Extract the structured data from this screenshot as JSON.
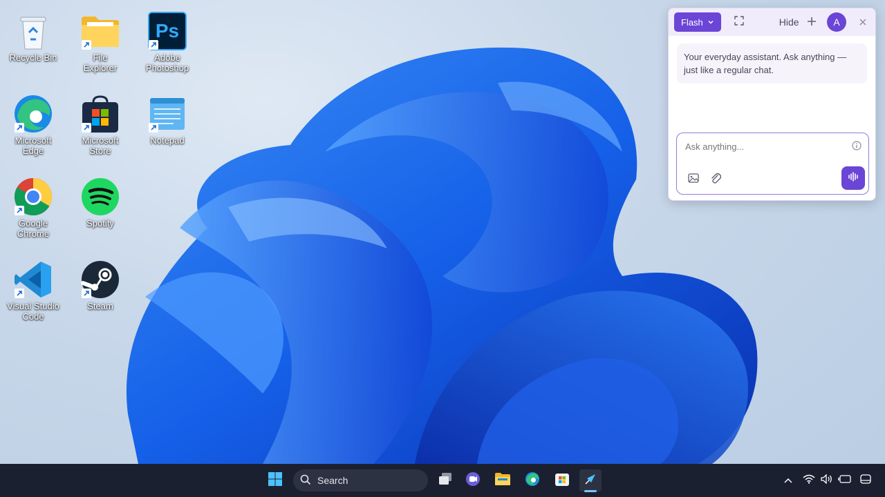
{
  "desktop": {
    "icons": [
      {
        "label": "Recycle Bin"
      },
      {
        "label": "File Explorer"
      },
      {
        "label": "Adobe Photoshop"
      },
      {
        "label": "Microsoft Edge"
      },
      {
        "label": "Microsoft Store"
      },
      {
        "label": "Notepad"
      },
      {
        "label": "Google Chrome"
      },
      {
        "label": "Spotify"
      },
      {
        "label": "Visual Studio Code"
      },
      {
        "label": "Steam"
      }
    ]
  },
  "assistant": {
    "model_label": "Flash",
    "hide_label": "Hide",
    "avatar_initial": "A",
    "intro_text": "Your everyday assistant. Ask anything — just like a regular chat.",
    "composer_placeholder": "Ask anything...",
    "accent_color": "#6b45d6"
  },
  "taskbar": {
    "search_label": "Search",
    "apps": [
      "start-icon",
      "task-view-icon",
      "teams-icon",
      "file-explorer-icon",
      "edge-icon",
      "store-icon",
      "assistant-icon"
    ],
    "tray": [
      "chevron-up-icon",
      "wifi-icon",
      "volume-icon",
      "battery-icon",
      "notification-icon"
    ]
  }
}
